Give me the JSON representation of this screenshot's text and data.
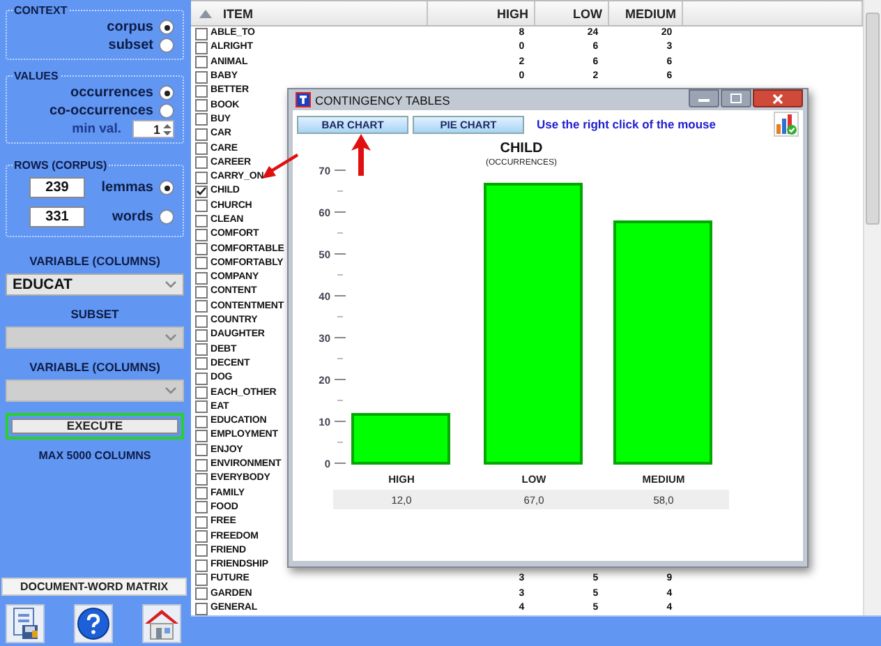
{
  "sidebar": {
    "context": {
      "title": "CONTEXT",
      "options": [
        {
          "label": "corpus",
          "selected": true
        },
        {
          "label": "subset",
          "selected": false
        }
      ]
    },
    "values": {
      "title": "VALUES",
      "options": [
        {
          "label": "occurrences",
          "selected": true
        },
        {
          "label": "co-occurrences",
          "selected": false
        }
      ],
      "min_val": {
        "label": "min val.",
        "value": "1"
      }
    },
    "rows": {
      "title": "ROWS (CORPUS)",
      "options": [
        {
          "count": "239",
          "label": "lemmas",
          "selected": true
        },
        {
          "count": "331",
          "label": "words",
          "selected": false
        }
      ]
    },
    "selects": [
      {
        "label": "VARIABLE (COLUMNS)",
        "value": "EDUCAT",
        "disabled": false
      },
      {
        "label": "SUBSET",
        "disabled": true
      },
      {
        "label": "VARIABLE (COLUMNS)",
        "disabled": true
      }
    ],
    "execute_button": "EXECUTE",
    "note": "MAX 5000 COLUMNS",
    "matrix_label": "DOCUMENT-WORD MATRIX"
  },
  "table": {
    "columns": [
      "ITEM",
      "HIGH",
      "LOW",
      "MEDIUM"
    ],
    "rows": [
      {
        "item": "ABLE_TO",
        "checked": false,
        "values": [
          "8",
          "24",
          "20"
        ]
      },
      {
        "item": "ALRIGHT",
        "checked": false,
        "values": [
          "0",
          "6",
          "3"
        ]
      },
      {
        "item": "ANIMAL",
        "checked": false,
        "values": [
          "2",
          "6",
          "6"
        ]
      },
      {
        "item": "BABY",
        "checked": false,
        "values": [
          "0",
          "2",
          "6"
        ]
      },
      {
        "item": "BETTER",
        "checked": false
      },
      {
        "item": "BOOK",
        "checked": false
      },
      {
        "item": "BUY",
        "checked": false
      },
      {
        "item": "CAR",
        "checked": false
      },
      {
        "item": "CARE",
        "checked": false
      },
      {
        "item": "CAREER",
        "checked": false
      },
      {
        "item": "CARRY_ON",
        "checked": false
      },
      {
        "item": "CHILD",
        "checked": true
      },
      {
        "item": "CHURCH",
        "checked": false
      },
      {
        "item": "CLEAN",
        "checked": false
      },
      {
        "item": "COMFORT",
        "checked": false
      },
      {
        "item": "COMFORTABLE",
        "checked": false
      },
      {
        "item": "COMFORTABLY",
        "checked": false
      },
      {
        "item": "COMPANY",
        "checked": false
      },
      {
        "item": "CONTENT",
        "checked": false
      },
      {
        "item": "CONTENTMENT",
        "checked": false
      },
      {
        "item": "COUNTRY",
        "checked": false
      },
      {
        "item": "DAUGHTER",
        "checked": false
      },
      {
        "item": "DEBT",
        "checked": false
      },
      {
        "item": "DECENT",
        "checked": false
      },
      {
        "item": "DOG",
        "checked": false
      },
      {
        "item": "EACH_OTHER",
        "checked": false
      },
      {
        "item": "EAT",
        "checked": false
      },
      {
        "item": "EDUCATION",
        "checked": false
      },
      {
        "item": "EMPLOYMENT",
        "checked": false
      },
      {
        "item": "ENJOY",
        "checked": false
      },
      {
        "item": "ENVIRONMENT",
        "checked": false
      },
      {
        "item": "EVERYBODY",
        "checked": false
      },
      {
        "item": "FAMILY",
        "checked": false
      },
      {
        "item": "FOOD",
        "checked": false
      },
      {
        "item": "FREE",
        "checked": false
      },
      {
        "item": "FREEDOM",
        "checked": false
      },
      {
        "item": "FRIEND",
        "checked": false
      },
      {
        "item": "FRIENDSHIP",
        "checked": false
      },
      {
        "item": "FUTURE",
        "checked": false,
        "values": [
          "3",
          "5",
          "9"
        ]
      },
      {
        "item": "GARDEN",
        "checked": false,
        "values": [
          "3",
          "5",
          "4"
        ]
      },
      {
        "item": "GENERAL",
        "checked": false,
        "values": [
          "4",
          "5",
          "4"
        ]
      }
    ]
  },
  "dialog": {
    "title": "CONTINGENCY TABLES",
    "buttons": [
      "BAR CHART",
      "PIE CHART"
    ],
    "hint": "Use the right click of the mouse",
    "chart_subtitle": "(OCCURRENCES)",
    "chart_data": {
      "type": "bar",
      "title": "CHILD",
      "categories": [
        "HIGH",
        "LOW",
        "MEDIUM"
      ],
      "series": [
        {
          "color": "#00ff00",
          "values": [
            12,
            67,
            58
          ]
        }
      ],
      "ylim": [
        0,
        70
      ],
      "yticks": [
        0,
        10,
        20,
        30,
        40,
        50,
        60,
        70
      ]
    },
    "data_table": [
      "12,0",
      "67,0",
      "58,0"
    ]
  }
}
